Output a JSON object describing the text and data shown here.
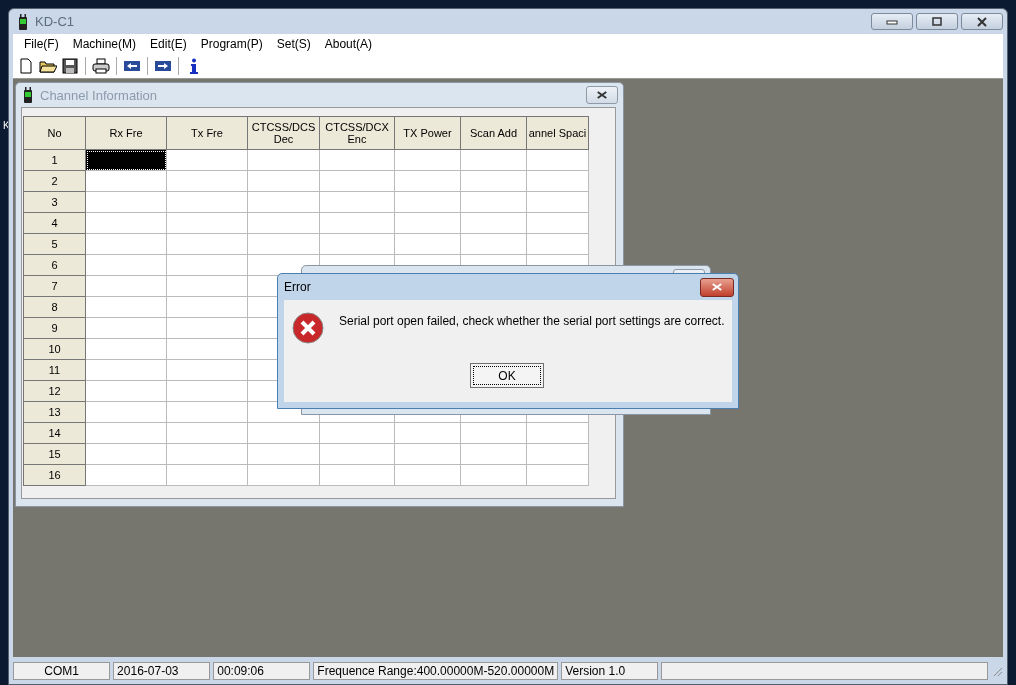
{
  "desktop_text": "K",
  "window": {
    "title": "KD-C1"
  },
  "menu": [
    "File(F)",
    "Machine(M)",
    "Edit(E)",
    "Program(P)",
    "Set(S)",
    "About(A)"
  ],
  "toolbar": [
    {
      "kind": "new"
    },
    {
      "kind": "open"
    },
    {
      "kind": "save"
    },
    {
      "kind": "sep"
    },
    {
      "kind": "print"
    },
    {
      "kind": "sep"
    },
    {
      "kind": "read"
    },
    {
      "kind": "sep"
    },
    {
      "kind": "write"
    },
    {
      "kind": "sep"
    },
    {
      "kind": "info"
    }
  ],
  "channel_window": {
    "title": "Channel Information",
    "table": {
      "columns": [
        "No",
        "Rx Fre",
        "Tx Fre",
        "CTCSS/DCS Dec",
        "CTCSS/DCX Enc",
        "TX Power",
        "Scan Add",
        "annel Spaci"
      ],
      "rows": [
        {
          "no": "1",
          "selected": true
        },
        {
          "no": "2",
          "selected": false
        },
        {
          "no": "3",
          "selected": false
        },
        {
          "no": "4",
          "selected": false
        },
        {
          "no": "5",
          "selected": false
        },
        {
          "no": "6",
          "selected": false
        },
        {
          "no": "7",
          "selected": false
        },
        {
          "no": "8",
          "selected": false
        },
        {
          "no": "9",
          "selected": false
        },
        {
          "no": "10",
          "selected": false
        },
        {
          "no": "11",
          "selected": false
        },
        {
          "no": "12",
          "selected": false
        },
        {
          "no": "13",
          "selected": false
        },
        {
          "no": "14",
          "selected": false
        },
        {
          "no": "15",
          "selected": false
        },
        {
          "no": "16",
          "selected": false
        }
      ]
    }
  },
  "error_dialog": {
    "title": "Error",
    "message": "Serial port open failed, check whether the serial port settings are correct.",
    "button": "OK"
  },
  "status_bar": [
    "COM1",
    "2016-07-03",
    "00:09:06",
    "Frequence Range:400.00000M-520.00000M",
    "Version 1.0"
  ]
}
